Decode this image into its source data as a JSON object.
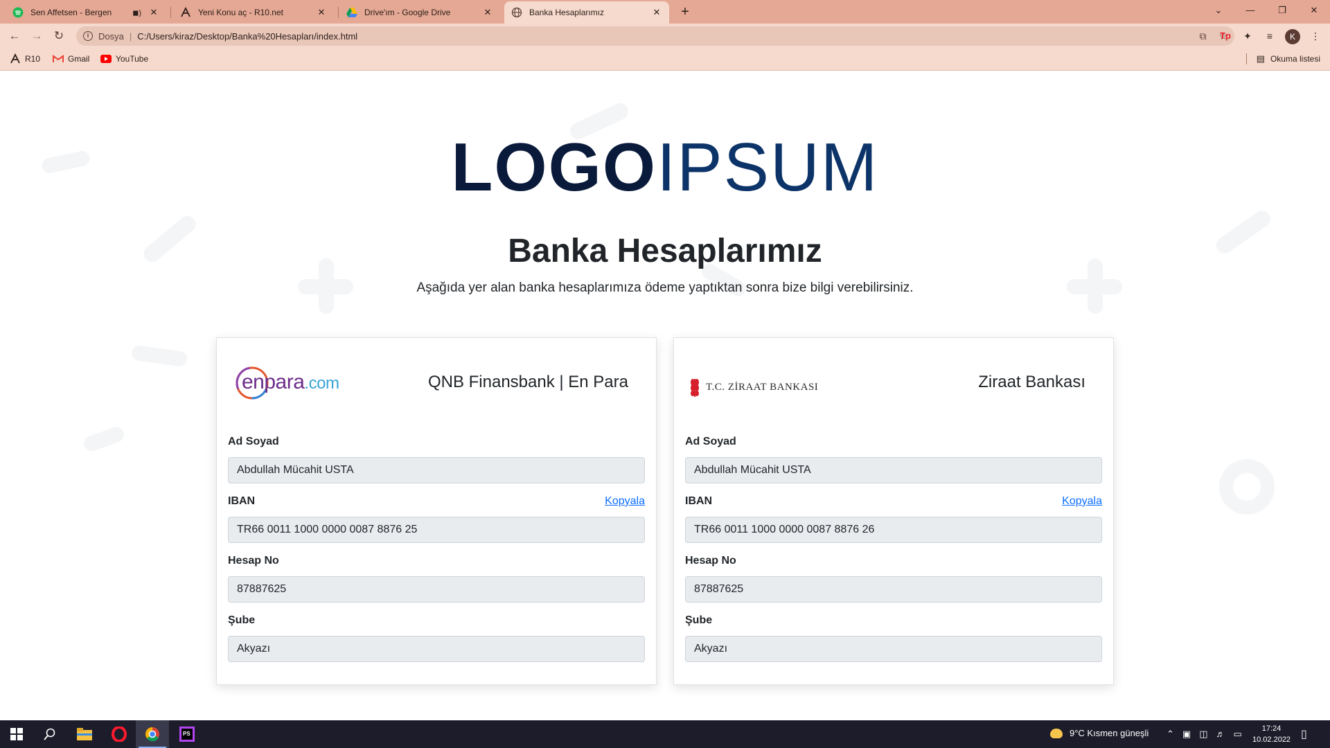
{
  "browser": {
    "tabs": [
      {
        "title": "Sen Affetsen - Bergen",
        "favicon": "spotify-icon"
      },
      {
        "title": "Yeni Konu aç - R10.net",
        "favicon": "r10-icon"
      },
      {
        "title": "Drive'ım - Google Drive",
        "favicon": "google-drive-icon"
      },
      {
        "title": "Banka Hesaplarımız",
        "favicon": "globe-icon"
      }
    ],
    "address": {
      "scheme": "Dosya",
      "url": "C:/Users/kiraz/Desktop/Banka%20Hesapları/index.html"
    },
    "bookmarks": [
      {
        "label": "R10",
        "icon": "r10-icon"
      },
      {
        "label": "Gmail",
        "icon": "gmail-icon"
      },
      {
        "label": "YouTube",
        "icon": "youtube-icon"
      }
    ],
    "reading_list": "Okuma listesi",
    "profile_initial": "K"
  },
  "page": {
    "logo": {
      "bold": "LOGO",
      "light": "IPSUM"
    },
    "title": "Banka Hesaplarımız",
    "subtitle": "Aşağıda yer alan banka hesaplarımıza ödeme yaptıktan sonra bize bilgi verebilirsiniz.",
    "labels": {
      "name": "Ad Soyad",
      "iban": "IBAN",
      "account": "Hesap No",
      "branch": "Şube",
      "copy": "Kopyala"
    },
    "accounts": [
      {
        "bank": "QNB Finansbank | En Para",
        "logo_parts": {
          "en": "en",
          "para": "para",
          "tld": ".com"
        },
        "name": "Abdullah Mücahit USTA",
        "iban": "TR66 0011 1000 0000 0087 8876 25",
        "account_no": "87887625",
        "branch": "Akyazı"
      },
      {
        "bank": "Ziraat Bankası",
        "logo_text": "T.C. ZİRAAT BANKASI",
        "name": "Abdullah Mücahit USTA",
        "iban": "TR66 0011 1000 0000 0087 8876 26",
        "account_no": "87887625",
        "branch": "Akyazı"
      }
    ]
  },
  "taskbar": {
    "weather": "9°C  Kısmen güneşli",
    "time": "17:24",
    "date": "10.02.2022"
  },
  "colors": {
    "tabstrip": "#e4a894",
    "toolbar": "#f6dacd",
    "logo_dark": "#0a1a3a",
    "logo_light": "#0d3468",
    "link": "#0d6efd",
    "ziraat_red": "#d6202c",
    "enpara_purple": "#6d2c8a"
  }
}
